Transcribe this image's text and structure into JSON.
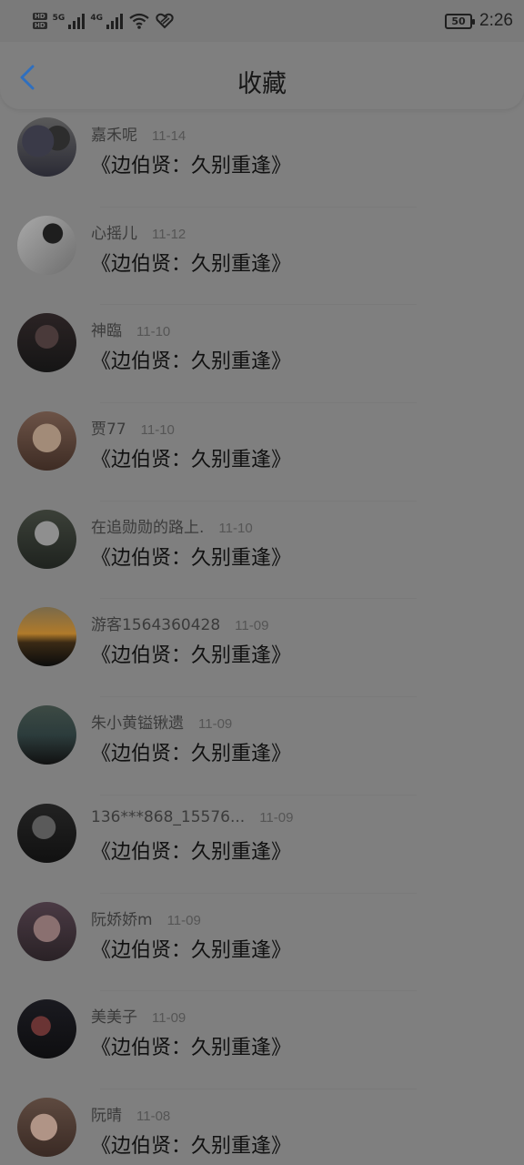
{
  "status_bar": {
    "sim1": "HD",
    "sim2": "HD",
    "net1": "5G",
    "net2": "4G",
    "battery": "50",
    "time": "2:26"
  },
  "header": {
    "back_icon": "chevron-left-icon",
    "title": "收藏",
    "accent_color": "#2f6fbf"
  },
  "items": [
    {
      "name": "嘉禾呢",
      "date": "11-14",
      "title": "《边伯贤：久别重逢》"
    },
    {
      "name": "心摇儿",
      "date": "11-12",
      "title": "《边伯贤：久别重逢》"
    },
    {
      "name": "神臨",
      "date": "11-10",
      "title": "《边伯贤：久别重逢》"
    },
    {
      "name": "贾77",
      "date": "11-10",
      "title": "《边伯贤：久别重逢》"
    },
    {
      "name": "在追勋勋的路上.",
      "date": "11-10",
      "title": "《边伯贤：久别重逢》"
    },
    {
      "name": "游客1564360428",
      "date": "11-09",
      "title": "《边伯贤：久别重逢》"
    },
    {
      "name": "朱小黄镒锹遗",
      "date": "11-09",
      "title": "《边伯贤：久别重逢》"
    },
    {
      "name": "136***868_15576...",
      "date": "11-09",
      "title": "《边伯贤：久别重逢》"
    },
    {
      "name": "阮娇娇m",
      "date": "11-09",
      "title": "《边伯贤：久别重逢》"
    },
    {
      "name": "美美子",
      "date": "11-09",
      "title": "《边伯贤：久别重逢》"
    },
    {
      "name": "阮晴",
      "date": "11-08",
      "title": "《边伯贤：久别重逢》"
    }
  ]
}
